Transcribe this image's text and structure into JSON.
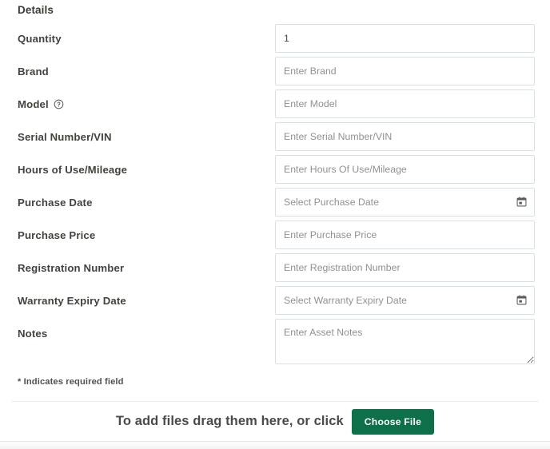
{
  "section": {
    "heading": "Details"
  },
  "fields": [
    {
      "label": "Quantity",
      "value": "1",
      "placeholder": "",
      "type": "text",
      "name": "quantity",
      "help": false
    },
    {
      "label": "Brand",
      "value": "",
      "placeholder": "Enter Brand",
      "type": "text",
      "name": "brand",
      "help": false
    },
    {
      "label": "Model",
      "value": "",
      "placeholder": "Enter Model",
      "type": "text",
      "name": "model",
      "help": true
    },
    {
      "label": "Serial Number/VIN",
      "value": "",
      "placeholder": "Enter Serial Number/VIN",
      "type": "text",
      "name": "serial-number-vin",
      "help": false
    },
    {
      "label": "Hours of Use/Mileage",
      "value": "",
      "placeholder": "Enter Hours Of Use/Mileage",
      "type": "text",
      "name": "hours-of-use-mileage",
      "help": false
    },
    {
      "label": "Purchase Date",
      "value": "",
      "placeholder": "Select Purchase Date",
      "type": "date",
      "name": "purchase-date",
      "help": false
    },
    {
      "label": "Purchase Price",
      "value": "",
      "placeholder": "Enter Purchase Price",
      "type": "text",
      "name": "purchase-price",
      "help": false
    },
    {
      "label": "Registration Number",
      "value": "",
      "placeholder": "Enter Registration Number",
      "type": "text",
      "name": "registration-number",
      "help": false
    },
    {
      "label": "Warranty Expiry Date",
      "value": "",
      "placeholder": "Select Warranty Expiry Date",
      "type": "date",
      "name": "warranty-expiry-date",
      "help": false
    }
  ],
  "notes": {
    "label": "Notes",
    "value": "",
    "placeholder": "Enter Asset Notes"
  },
  "footer": {
    "required_note": "* Indicates required field"
  },
  "upload": {
    "text": "To add files drag them here, or click",
    "button_label": "Choose File"
  },
  "icons": {
    "help": "help-circle-icon",
    "calendar": "calendar-icon"
  },
  "colors": {
    "accent_green": "#0d7048",
    "field_border": "#d6e1e7",
    "label_text": "#43433e",
    "placeholder_text": "#8e9196"
  }
}
